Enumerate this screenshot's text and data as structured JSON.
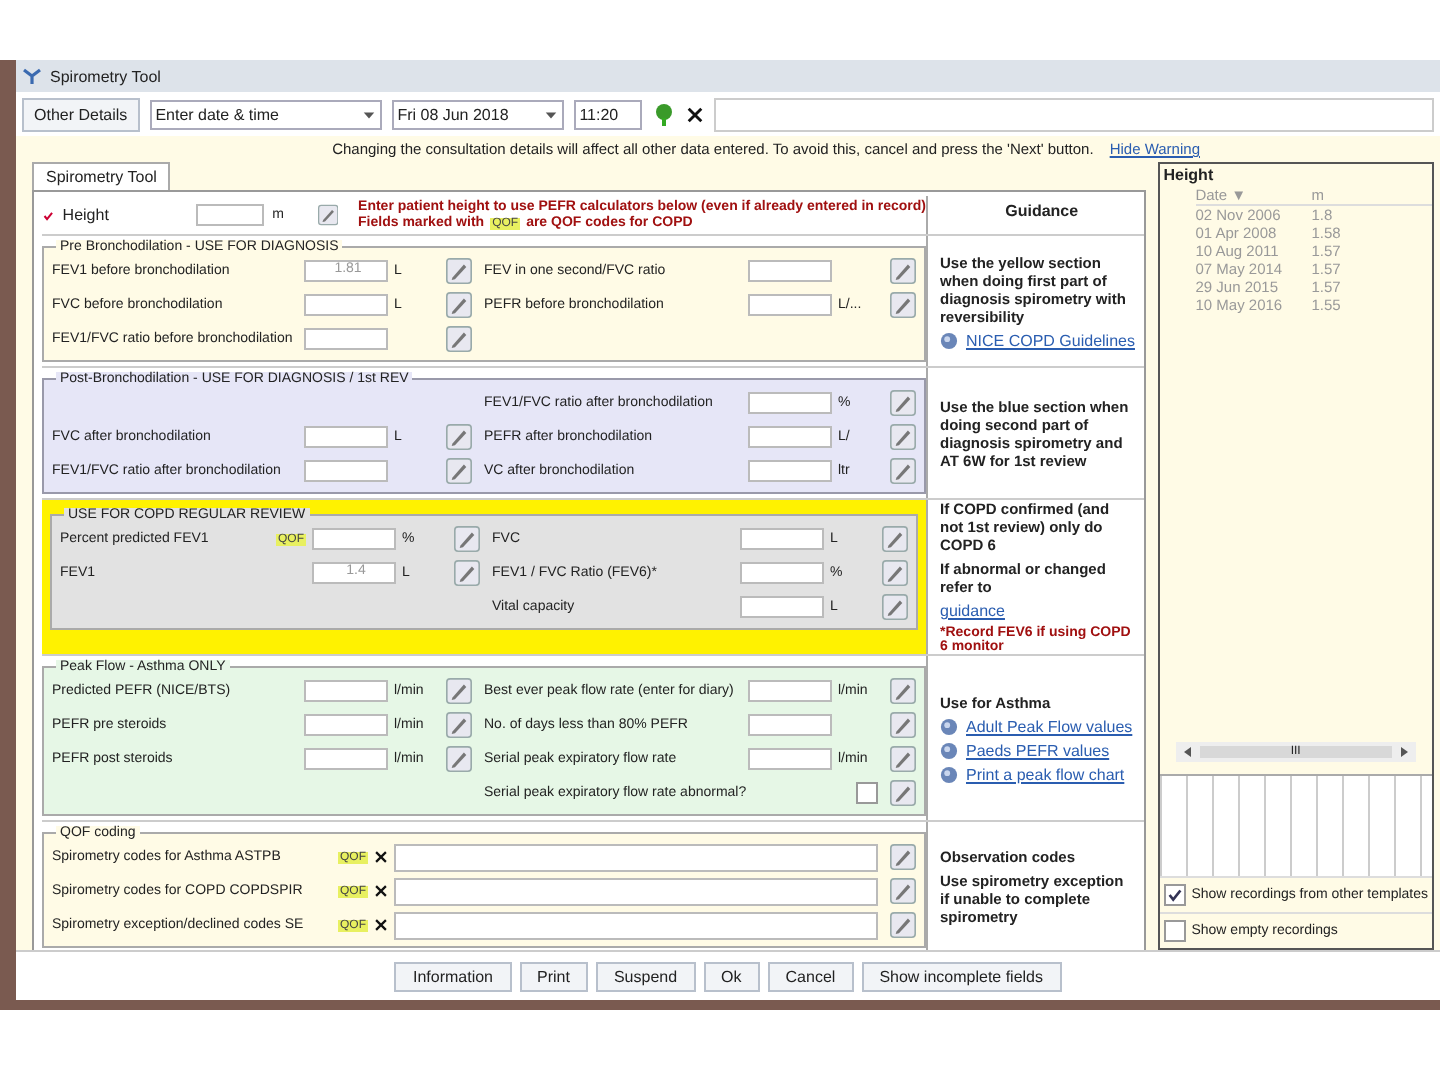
{
  "window": {
    "title": "Spirometry Tool"
  },
  "toolbar": {
    "other_details": "Other Details",
    "entry_type": "Enter date & time",
    "date": "Fri 08 Jun 2018",
    "time": "11:20"
  },
  "warning": {
    "text": "Changing the consultation details will affect all other data entered. To avoid this, cancel and press the 'Next' button.",
    "link": "Hide Warning"
  },
  "tabs": [
    {
      "label": "Spirometry Tool",
      "selected": true
    }
  ],
  "height_row": {
    "label": "Height",
    "unit": "m",
    "note_1": "Enter patient height to use PEFR calculators below (even if already entered in record)",
    "note_2_before": "Fields marked with",
    "badge": "QOF",
    "note_2_after": "are QOF codes for COPD",
    "guidance_heading": "Guidance"
  },
  "sections": [
    {
      "kind": "pre",
      "title": "Pre Bronchodilation - USE FOR DIAGNOSIS",
      "left": [
        {
          "label": "FEV1 before bronchodilation",
          "value": "1.81",
          "unit": "L",
          "kind": "number"
        },
        {
          "label": "FVC before bronchodilation",
          "unit": "L",
          "kind": "number"
        },
        {
          "label": "FEV1/FVC ratio before bronchodilation",
          "kind": "number"
        }
      ],
      "right": [
        {
          "label": "FEV in one second/FVC ratio",
          "kind": "number"
        },
        {
          "label": "PEFR before bronchodilation",
          "unit": "L/...",
          "kind": "number"
        }
      ],
      "guidance": [
        {
          "kind": "bold",
          "text": "Use the yellow section when doing first part of diagnosis spirometry with reversibility"
        },
        {
          "kind": "globe-link",
          "text": "NICE COPD Guidelines"
        }
      ]
    },
    {
      "kind": "post",
      "title": "Post-Bronchodilation - USE FOR DIAGNOSIS / 1st REV",
      "left": [
        {
          "label": "FVC after bronchodilation",
          "unit": "L",
          "kind": "number"
        },
        {
          "label": "FEV1/FVC ratio after bronchodilation",
          "kind": "number"
        }
      ],
      "right": [
        {
          "label": "FEV1/FVC ratio after bronchodilation",
          "unit": "%",
          "kind": "number"
        },
        {
          "label": "PEFR after bronchodilation",
          "unit": "L/",
          "kind": "number"
        },
        {
          "label": "VC after bronchodilation",
          "unit": "ltr",
          "kind": "number"
        }
      ],
      "guidance": [
        {
          "kind": "bold",
          "text": "Use the blue section when doing second part of diagnosis spirometry and AT 6W for 1st review"
        }
      ]
    },
    {
      "kind": "review",
      "title": "USE FOR COPD REGULAR REVIEW",
      "left": [
        {
          "label": "Percent predicted FEV1",
          "badge": "QOF",
          "unit": "%",
          "kind": "number"
        },
        {
          "label": "FEV1",
          "value": "1.4",
          "unit": "L",
          "kind": "number"
        }
      ],
      "right": [
        {
          "label": "FVC",
          "unit": "L",
          "kind": "number"
        },
        {
          "label": "FEV1 / FVC Ratio (FEV6)*",
          "unit": "%",
          "kind": "number"
        },
        {
          "label": "Vital capacity",
          "unit": "L",
          "kind": "number"
        }
      ],
      "guidance": [
        {
          "kind": "bold",
          "text": "If COPD confirmed (and not 1st review) only do COPD 6"
        },
        {
          "kind": "bold",
          "text": "If abnormal or changed refer to"
        },
        {
          "kind": "link",
          "text": "guidance"
        },
        {
          "kind": "red",
          "text": "*Record FEV6 if using COPD 6 monitor"
        }
      ]
    },
    {
      "kind": "peak",
      "title": "Peak Flow - Asthma ONLY",
      "left": [
        {
          "label": "Predicted PEFR (NICE/BTS)",
          "unit": "l/min",
          "kind": "number"
        },
        {
          "label": "PEFR pre steroids",
          "unit": "l/min",
          "kind": "number"
        },
        {
          "label": "PEFR post steroids",
          "unit": "l/min",
          "kind": "number"
        }
      ],
      "right": [
        {
          "label": "Best ever peak flow rate (enter for diary)",
          "unit": "l/min",
          "kind": "number"
        },
        {
          "label": "No. of days less than 80% PEFR",
          "kind": "number"
        },
        {
          "label": "Serial peak expiratory flow rate",
          "unit": "l/min",
          "kind": "number"
        },
        {
          "label": "Serial peak expiratory flow rate abnormal?",
          "checked": false,
          "kind": "checkbox"
        }
      ],
      "guidance": [
        {
          "kind": "bold",
          "text": "Use for Asthma"
        },
        {
          "kind": "globe-link",
          "text": "Adult Peak Flow values"
        },
        {
          "kind": "globe-link",
          "text": "Paeds PEFR values"
        },
        {
          "kind": "globe-link",
          "text": "Print a peak flow chart"
        }
      ]
    },
    {
      "kind": "qof",
      "title": "QOF coding",
      "left": [
        {
          "label": "Spirometry codes for Asthma ASTPB",
          "badge": "QOF",
          "kind": "code"
        },
        {
          "label": "Spirometry codes for COPD COPDSPIR",
          "badge": "QOF",
          "kind": "code"
        },
        {
          "label": "Spirometry exception/declined codes SE",
          "badge": "QOF",
          "kind": "code"
        }
      ],
      "guidance": [
        {
          "kind": "bold",
          "text": "Observation codes"
        },
        {
          "kind": "bold",
          "text": "Use spirometry exception if unable to complete spirometry"
        }
      ]
    }
  ],
  "history": {
    "title": "Height",
    "columns": [
      "Date ▼",
      "m"
    ],
    "rows": [
      [
        "02 Nov 2006",
        "1.8"
      ],
      [
        "01 Apr 2008",
        "1.58"
      ],
      [
        "10 Aug 2011",
        "1.57"
      ],
      [
        "07 May 2014",
        "1.57"
      ],
      [
        "29 Jun 2015",
        "1.57"
      ],
      [
        "10 May 2016",
        "1.55"
      ]
    ],
    "scroll_label": "III",
    "options": [
      {
        "label": "Show recordings from other templates",
        "checked": true
      },
      {
        "label": "Show empty recordings",
        "checked": false
      }
    ]
  },
  "buttons": [
    "Information",
    "Print",
    "Suspend",
    "Ok",
    "Cancel",
    "Show incomplete fields"
  ]
}
